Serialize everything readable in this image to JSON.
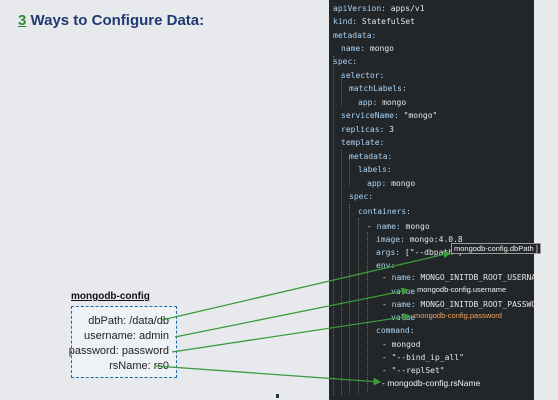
{
  "title": {
    "number": "3",
    "text": " Ways to Configure Data:"
  },
  "config_map": {
    "name": "mongodb-config",
    "lines": [
      "dbPath: /data/db",
      "username: admin",
      "password: password",
      "rsName: rs0"
    ]
  },
  "yaml": {
    "l01": {
      "k": "apiVersion:",
      "v": " apps/v1"
    },
    "l02": {
      "k": "kind:",
      "v": " StatefulSet"
    },
    "l03": {
      "k": "metadata:"
    },
    "l04": {
      "k": "name:",
      "v": " mongo"
    },
    "l05": {
      "k": "spec:"
    },
    "l06": {
      "k": "selector:"
    },
    "l07": {
      "k": "matchLabels:"
    },
    "l08": {
      "k": "app:",
      "v": " mongo"
    },
    "l09": {
      "k": "serviceName:",
      "v": " \"mongo\""
    },
    "l10": {
      "k": "replicas:",
      "v": " 3"
    },
    "l11": {
      "k": "template:"
    },
    "l12": {
      "k": "metadata:"
    },
    "l13": {
      "k": "labels:"
    },
    "l14": {
      "k": "app:",
      "v": " mongo"
    },
    "l15": {
      "k": "spec:"
    },
    "l16": {
      "k": "containers:"
    },
    "l17": {
      "d": "- ",
      "k": "name:",
      "v": " mongo"
    },
    "l18": {
      "k": "image:",
      "v": " mongo:4.0.8"
    },
    "l19": {
      "k": "args:",
      "v": " [\"--dbpath\","
    },
    "l20": {
      "k": "env:"
    },
    "l21": {
      "d": "- ",
      "k": "name:",
      "v": " MONGO_INITDB_ROOT_USERNAME"
    },
    "l22": {
      "k": "value"
    },
    "l23": {
      "d": "- ",
      "k": "name:",
      "v": " MONGO_INITDB_ROOT_PASSWORD"
    },
    "l24": {
      "k": "value"
    },
    "l25": {
      "k": "command:"
    },
    "l26": {
      "d": "- ",
      "v": "mongod"
    },
    "l27": {
      "d": "- ",
      "v": "\"--bind_ip_all\""
    },
    "l28": {
      "d": "- ",
      "v": "\"--replSet\""
    }
  },
  "refs": {
    "dbpath": "mongodb-config.dbPath ]",
    "username": "mongodb-config.username",
    "password": "mongodb-config.password",
    "rsname": "- mongodb-config.rsName"
  },
  "colors": {
    "title": "#1f3a73",
    "title_number": "#2e8b3a",
    "arrow": "#3d9a3d",
    "code_bg": "#232629"
  }
}
